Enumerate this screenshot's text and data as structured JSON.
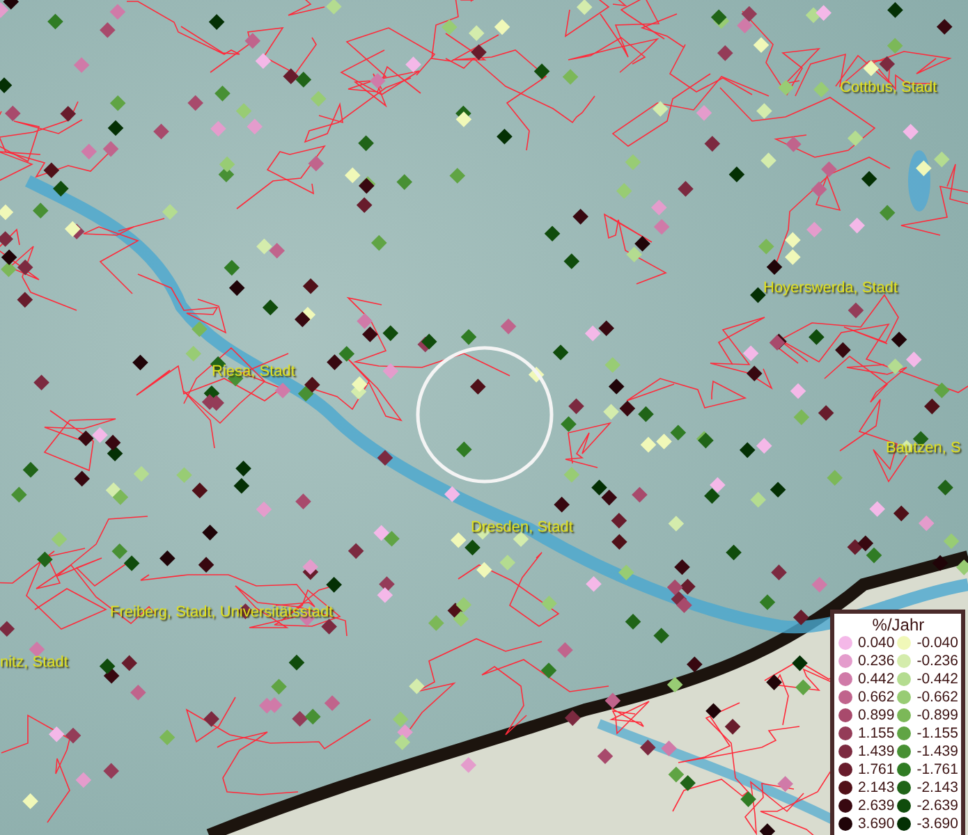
{
  "map": {
    "places": [
      {
        "label": "Cottbus, Stadt"
      },
      {
        "label": "Hoyerswerda, Stadt"
      },
      {
        "label": "Riesa, Stadt"
      },
      {
        "label": "Bautzen, S"
      },
      {
        "label": "Dresden, Stadt"
      },
      {
        "label": "Freiberg, Stadt, Universitätsstadt"
      },
      {
        "label": "nitz, Stadt"
      }
    ]
  },
  "legend": {
    "title": "%/Jahr",
    "rising": [
      {
        "label": "0.040",
        "color": "#f4b8e8"
      },
      {
        "label": "0.236",
        "color": "#e49ccc"
      },
      {
        "label": "0.442",
        "color": "#d07aa8"
      },
      {
        "label": "0.662",
        "color": "#c0648c"
      },
      {
        "label": "0.899",
        "color": "#a84a6c"
      },
      {
        "label": "1.155",
        "color": "#943c58"
      },
      {
        "label": "1.439",
        "color": "#7c2a40"
      },
      {
        "label": "1.761",
        "color": "#681c2c"
      },
      {
        "label": "2.143",
        "color": "#501018"
      },
      {
        "label": "2.639",
        "color": "#380810"
      },
      {
        "label": "3.690",
        "color": "#200408"
      }
    ],
    "falling": [
      {
        "label": "-0.040",
        "color": "#f0f8b8"
      },
      {
        "label": "-0.236",
        "color": "#d4ecac"
      },
      {
        "label": "-0.442",
        "color": "#b4dc90"
      },
      {
        "label": "-0.662",
        "color": "#98cc74"
      },
      {
        "label": "-0.899",
        "color": "#7cb858"
      },
      {
        "label": "-1.155",
        "color": "#60a444"
      },
      {
        "label": "-1.439",
        "color": "#489034"
      },
      {
        "label": "-1.761",
        "color": "#307c24"
      },
      {
        "label": "-2.143",
        "color": "#206418"
      },
      {
        "label": "-2.639",
        "color": "#104c0c"
      },
      {
        "label": "-3.690",
        "color": "#043004"
      }
    ]
  }
}
